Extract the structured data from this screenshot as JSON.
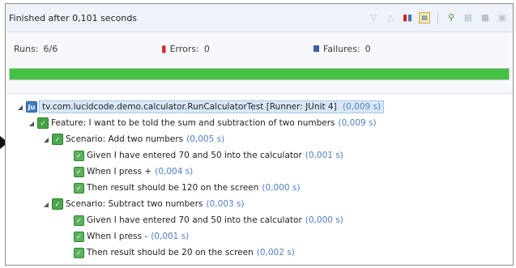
{
  "toolbar": {
    "status": "Finished after 0,101 seconds",
    "icons": [
      "next-failure-icon",
      "previous-failure-icon",
      "show-failures-only-icon",
      "history-icon",
      "search-icon",
      "scroll-lock-icon",
      "stop-icon",
      "menu-icon"
    ]
  },
  "counters": {
    "runs_label": "Runs:",
    "runs_value": "6/6",
    "errors_label": "Errors:",
    "errors_value": "0",
    "failures_label": "Failures:",
    "failures_value": "0",
    "progress_fraction": 1.0,
    "progress_color": "#44c044"
  },
  "tree": {
    "suite": {
      "label": "tv.com.lucidcode.demo.calculator.RunCalculatorTest [Runner: JUnit 4]",
      "time": "(0,009 s)"
    },
    "feature": {
      "label": "Feature: I want to be told the sum and subtraction of two numbers",
      "time": "(0,009 s)"
    },
    "scenarios": [
      {
        "label": "Scenario: Add two numbers",
        "time": "(0,005 s)",
        "steps": [
          {
            "label": "Given I have entered 70 and 50 into the calculator",
            "time": "(0,001 s)"
          },
          {
            "label": "When I press +",
            "time": "(0,004 s)"
          },
          {
            "label": "Then result should be 120 on the screen",
            "time": "(0,000 s)"
          }
        ]
      },
      {
        "label": "Scenario: Subtract two numbers",
        "time": "(0,003 s)",
        "steps": [
          {
            "label": "Given I have entered 70 and 50 into the calculator",
            "time": "(0,000 s)"
          },
          {
            "label": "When I press -",
            "time": "(0,001 s)"
          },
          {
            "label": "Then result should be 20 on the screen",
            "time": "(0,002 s)"
          }
        ]
      }
    ]
  }
}
